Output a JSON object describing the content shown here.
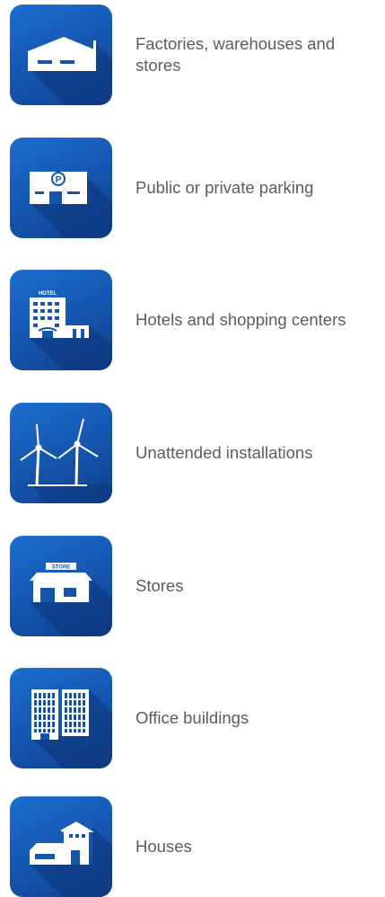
{
  "items": [
    {
      "icon": "factory-icon",
      "label": "Factories, warehouses and stores"
    },
    {
      "icon": "parking-icon",
      "label": "Public or private parking"
    },
    {
      "icon": "hotel-icon",
      "label": "Hotels and shopping centers",
      "sign": "HOTEL"
    },
    {
      "icon": "wind-turbine-icon",
      "label": "Unattended installations"
    },
    {
      "icon": "store-icon",
      "label": "Stores",
      "sign": "STORE"
    },
    {
      "icon": "office-building-icon",
      "label": "Office buildings"
    },
    {
      "icon": "house-icon",
      "label": "Houses"
    }
  ],
  "colors": {
    "tile": "#1554ad",
    "shadow": "#0c3579",
    "glyph": "#ffffff",
    "text": "#5c5c5c"
  }
}
